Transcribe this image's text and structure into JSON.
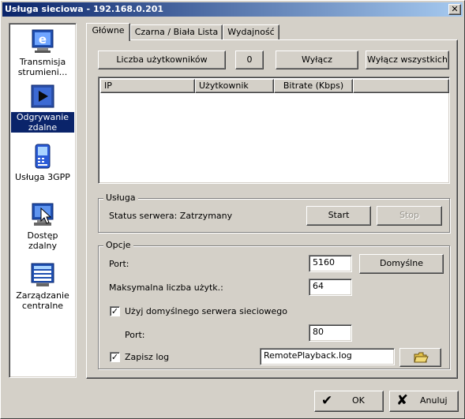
{
  "window": {
    "title": "Usługa sieciowa - 192.168.0.201",
    "close": "✕"
  },
  "sidebar": {
    "items": [
      {
        "label": "Transmisja strumieni...",
        "icon": "streaming-icon"
      },
      {
        "label": "Odgrywanie zdalne",
        "icon": "playback-icon",
        "selected": true
      },
      {
        "label": "Usługa 3GPP",
        "icon": "mobile-phone-icon"
      },
      {
        "label": "Dostęp zdalny",
        "icon": "remote-access-icon"
      },
      {
        "label": "Zarządzanie centralne",
        "icon": "central-management-icon"
      }
    ]
  },
  "tabs": [
    {
      "label": "Główne",
      "active": true
    },
    {
      "label": "Czarna / Biała Lista"
    },
    {
      "label": "Wydajność"
    }
  ],
  "main": {
    "users_count_label": "Liczba użytkowników",
    "users_count_value": "0",
    "disconnect_button": "Wyłącz",
    "disconnect_all_button": "Wyłącz wszystkich",
    "table": {
      "columns": [
        "IP",
        "Użytkownik",
        "Bitrate (Kbps)",
        ""
      ],
      "rows": []
    },
    "service": {
      "title": "Usługa",
      "status_text": "Status serwera: Zatrzymany",
      "start_button": "Start",
      "stop_button": "Stop"
    },
    "options": {
      "title": "Opcje",
      "port_label": "Port:",
      "port_value": "5160",
      "default_button": "Domyślne",
      "max_users_label": "Maksymalna liczba użytk.:",
      "max_users_value": "64",
      "use_default_web_server_label": "Użyj domyślnego serwera sieciowego",
      "use_default_web_server_checked": true,
      "web_port_label": "Port:",
      "web_port_value": "80",
      "save_log_label": "Zapisz log",
      "save_log_checked": true,
      "log_file_value": "RemotePlayback.log",
      "browse_icon": "folder-open-icon"
    }
  },
  "footer": {
    "ok_label": "OK",
    "cancel_label": "Anuluj"
  },
  "colors": {
    "title_start": "#0a246a",
    "title_end": "#a6caf0",
    "face": "#d4d0c8",
    "selection": "#0a246a"
  }
}
